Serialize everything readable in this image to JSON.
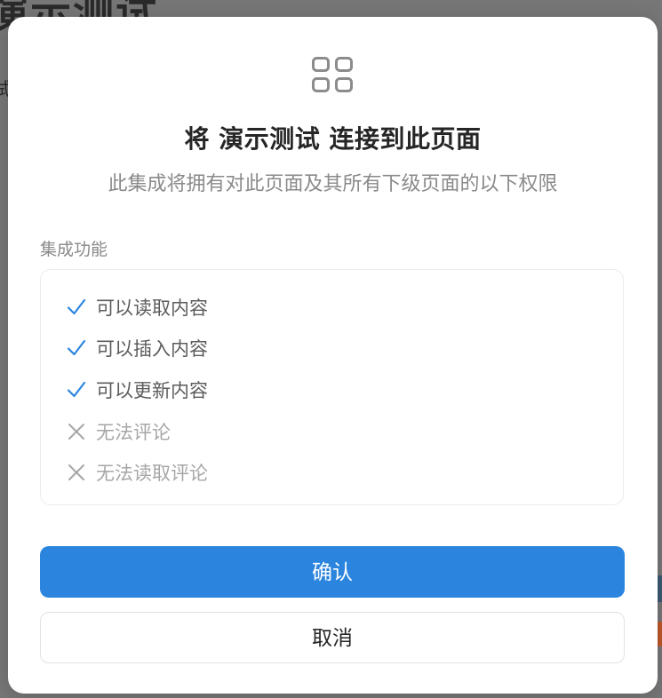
{
  "background": {
    "title": "演示测试",
    "subtitle": "试"
  },
  "modal": {
    "icon": "grid-icon",
    "title": "将 演示测试 连接到此页面",
    "subtitle": "此集成将拥有对此页面及其所有下级页面的以下权限",
    "section_label": "集成功能",
    "permissions": [
      {
        "label": "可以读取内容",
        "allowed": true,
        "icon": "check-icon"
      },
      {
        "label": "可以插入内容",
        "allowed": true,
        "icon": "check-icon"
      },
      {
        "label": "可以更新内容",
        "allowed": true,
        "icon": "check-icon"
      },
      {
        "label": "无法评论",
        "allowed": false,
        "icon": "cross-icon"
      },
      {
        "label": "无法读取评论",
        "allowed": false,
        "icon": "cross-icon"
      }
    ],
    "confirm_label": "确认",
    "cancel_label": "取消"
  },
  "colors": {
    "accent": "#2b85de",
    "check": "#2b85de",
    "cross": "#a6a6a6",
    "overlay": "#777777"
  }
}
